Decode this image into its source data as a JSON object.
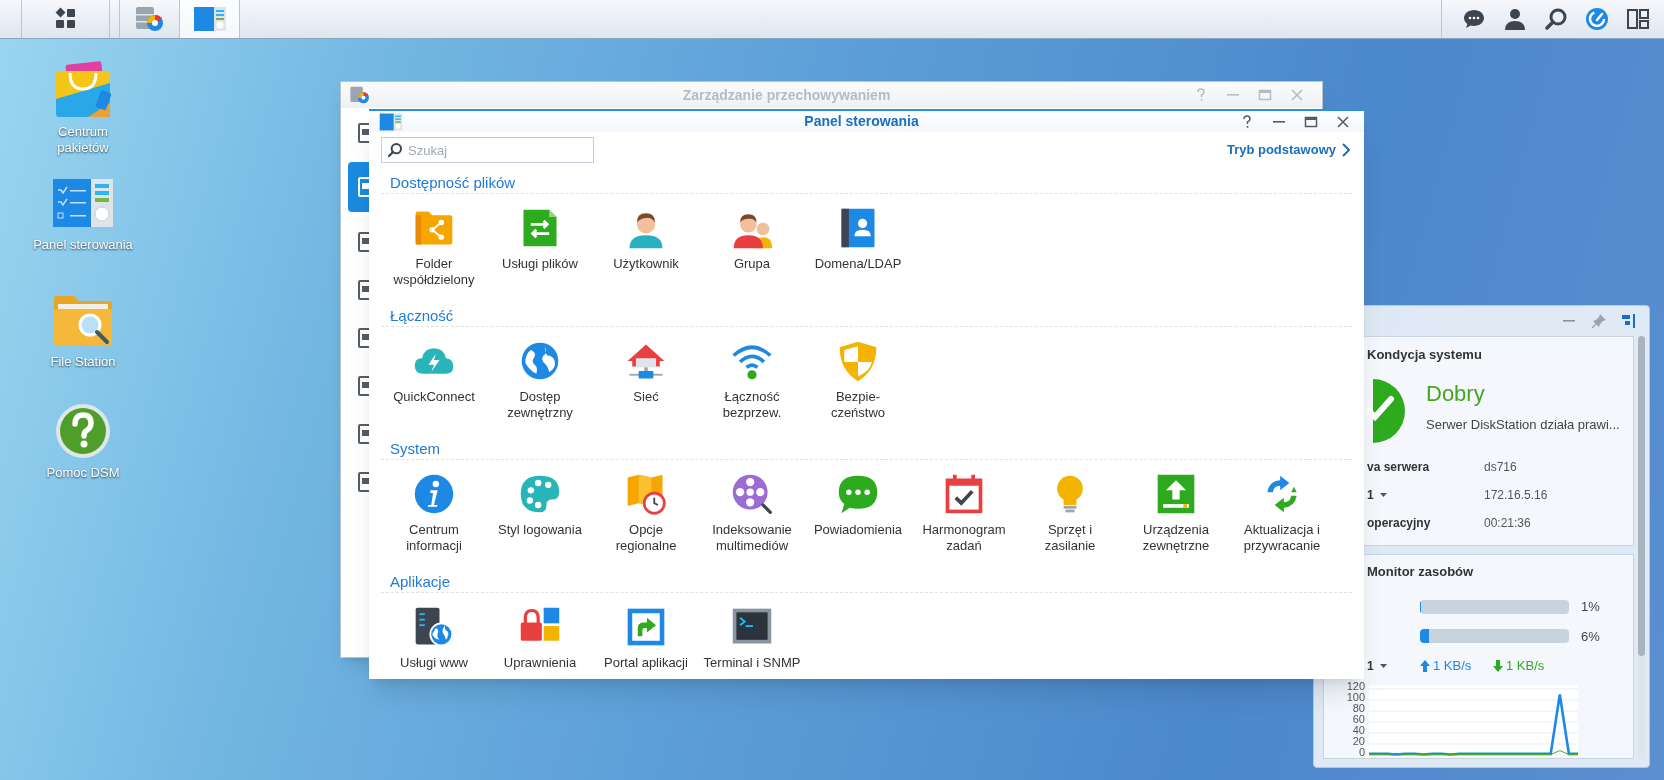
{
  "desktop_icons": [
    {
      "label": "Centrum\npakietów"
    },
    {
      "label": "Panel sterowania"
    },
    {
      "label": "File Station"
    },
    {
      "label": "Pomoc DSM"
    }
  ],
  "storage_window": {
    "title": "Zarządzanie przechowywaniem",
    "sidebar": [
      {
        "selected": false
      },
      {
        "selected": true
      },
      {
        "selected": false
      },
      {
        "selected": false
      },
      {
        "selected": false
      },
      {
        "selected": false
      },
      {
        "selected": false
      },
      {
        "selected": false
      }
    ]
  },
  "control_panel": {
    "title": "Panel sterowania",
    "search": {
      "placeholder": "Szukaj"
    },
    "mode_link": "Tryb podstawowy",
    "sections": [
      {
        "heading": "Dostępność plików",
        "items": [
          {
            "label": "Folder\nwspółdzielony"
          },
          {
            "label": "Usługi plików"
          },
          {
            "label": "Użytkownik"
          },
          {
            "label": "Grupa"
          },
          {
            "label": "Domena/LDAP"
          }
        ]
      },
      {
        "heading": "Łączność",
        "items": [
          {
            "label": "QuickConnect"
          },
          {
            "label": "Dostęp\nzewnętrzny"
          },
          {
            "label": "Sieć"
          },
          {
            "label": "Łączność\nbezprzew."
          },
          {
            "label": "Bezpie-\nczeństwo"
          }
        ]
      },
      {
        "heading": "System",
        "items": [
          {
            "label": "Centrum\ninformacji"
          },
          {
            "label": "Styl logowania"
          },
          {
            "label": "Opcje\nregionalne"
          },
          {
            "label": "Indeksowanie\nmultimediów"
          },
          {
            "label": "Powiadomienia"
          },
          {
            "label": "Harmonogram\nzadań"
          },
          {
            "label": "Sprzęt i\nzasilanie"
          },
          {
            "label": "Urządzenia\nzewnętrzne"
          },
          {
            "label": "Aktualizacja i\nprzywracanie"
          }
        ]
      },
      {
        "heading": "Aplikacje",
        "items": [
          {
            "label": "Usługi www"
          },
          {
            "label": "Uprawnienia"
          },
          {
            "label": "Portal aplikacji"
          },
          {
            "label": "Terminal i SNMP"
          }
        ]
      }
    ]
  },
  "widget": {
    "system_health": {
      "title": "Kondycja systemu",
      "status": "Dobry",
      "message": "Serwer DiskStation działa prawi...",
      "rows": [
        {
          "label": "va serwera",
          "dropdown": false,
          "value": "ds716"
        },
        {
          "label": "1",
          "dropdown": true,
          "value": "172.16.5.16"
        },
        {
          "label": "operacyjny",
          "dropdown": false,
          "value": "00:21:36"
        }
      ]
    },
    "resource_monitor": {
      "title": "Monitor zasobów",
      "meters": [
        {
          "level": 0.01,
          "reading": "1%"
        },
        {
          "level": 0.06,
          "reading": "6%"
        }
      ],
      "network": {
        "label": "1",
        "dropdown": true,
        "upload": "1 KB/s",
        "download": "1 KB/s"
      },
      "chart_data": {
        "type": "line",
        "grid": true,
        "ylim": [
          0,
          120
        ],
        "yticks": [
          0,
          20,
          40,
          60,
          80,
          100,
          120
        ],
        "series": [
          {
            "color": "#1e88e5",
            "values": [
              2,
              2,
              2,
              1,
              2,
              2,
              1,
              2,
              2,
              1,
              2,
              2,
              2,
              2,
              2,
              2,
              2,
              2,
              2,
              2,
              2,
              110,
              2,
              2
            ]
          },
          {
            "color": "#3fae29",
            "values": [
              1,
              1,
              1,
              3,
              1,
              1,
              1,
              1,
              1,
              1,
              1,
              1,
              1,
              1,
              1,
              1,
              1,
              1,
              1,
              1,
              1,
              8,
              1,
              1
            ]
          }
        ]
      }
    }
  }
}
